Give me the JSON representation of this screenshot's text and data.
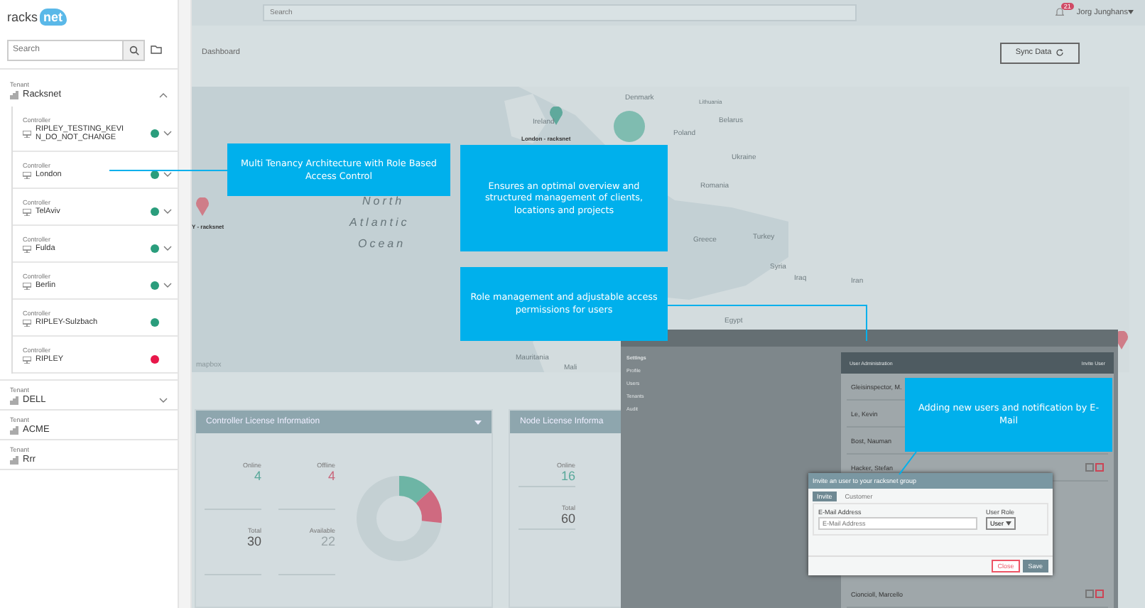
{
  "logo": {
    "part_a": "racks",
    "part_b": "net"
  },
  "sidebar": {
    "search": {
      "placeholder": "Search"
    },
    "tenants": [
      {
        "label": "Tenant",
        "name": "Racksnet",
        "expandable": true,
        "expanded": true,
        "children": [
          {
            "label": "Controller",
            "name": "RIPLEY_TESTING_KEVIN_DO_NOT_CHANGE",
            "color": "#2a9d7c",
            "expandable": true
          },
          {
            "label": "Controller",
            "name": "London",
            "color": "#2a9d7c",
            "expandable": true
          },
          {
            "label": "Controller",
            "name": "TelAviv",
            "color": "#2a9d7c",
            "expandable": true
          },
          {
            "label": "Controller",
            "name": "Fulda",
            "color": "#2a9d7c",
            "expandable": true
          },
          {
            "label": "Controller",
            "name": "Berlin",
            "color": "#2a9d7c",
            "expandable": true
          },
          {
            "label": "Controller",
            "name": "RIPLEY-Sulzbach",
            "color": "#2a9d7c",
            "expandable": false
          },
          {
            "label": "Controller",
            "name": "RIPLEY",
            "color": "#e8174a",
            "expandable": false
          }
        ]
      },
      {
        "label": "Tenant",
        "name": "DELL",
        "expandable": true,
        "expanded": false
      },
      {
        "label": "Tenant",
        "name": "ACME"
      },
      {
        "label": "Tenant",
        "name": "Rrr"
      }
    ]
  },
  "topbar": {
    "search": {
      "placeholder": "Search"
    },
    "notifications": "21",
    "user": "Jorg Junghans"
  },
  "dashboard": {
    "title": "Dashboard",
    "sync_button": "Sync Data"
  },
  "map": {
    "labels": [
      {
        "text": "Denmark",
        "kind": "country"
      },
      {
        "text": "Lithuania",
        "kind": "small"
      },
      {
        "text": "Belarus",
        "kind": "country"
      },
      {
        "text": "Poland",
        "kind": "country"
      },
      {
        "text": "Ireland",
        "kind": "country"
      },
      {
        "text": "London - racksnet",
        "kind": "pin"
      },
      {
        "text": "Ukraine",
        "kind": "country"
      },
      {
        "text": "Romania",
        "kind": "country"
      },
      {
        "text": "Greece",
        "kind": "country"
      },
      {
        "text": "Turkey",
        "kind": "country"
      },
      {
        "text": "Syria",
        "kind": "country"
      },
      {
        "text": "Iraq",
        "kind": "country"
      },
      {
        "text": "Iran",
        "kind": "country"
      },
      {
        "text": "Egypt",
        "kind": "country"
      },
      {
        "text": "Mauritania",
        "kind": "country"
      },
      {
        "text": "Mali",
        "kind": "country"
      },
      {
        "text": "North",
        "kind": "ocean"
      },
      {
        "text": "Atlantic",
        "kind": "ocean"
      },
      {
        "text": "Ocean",
        "kind": "ocean"
      },
      {
        "text": "Y - racksnet",
        "kind": "pin"
      }
    ],
    "markers": [
      {
        "kind": "pin",
        "color": "#5fa99c"
      },
      {
        "kind": "cluster",
        "color": "#7fbcb0"
      },
      {
        "kind": "pin",
        "color": "#cf7d88"
      },
      {
        "kind": "pin",
        "color": "#cf7d88"
      }
    ],
    "attribution": "mapbox"
  },
  "cards": [
    {
      "title": "Controller License Information",
      "stats": [
        {
          "label": "Online",
          "value": "4",
          "kind": "online"
        },
        {
          "label": "Offline",
          "value": "4",
          "kind": "offline"
        },
        {
          "label": "Total",
          "value": "30",
          "kind": "total"
        },
        {
          "label": "Available",
          "value": "22",
          "kind": "available"
        }
      ]
    },
    {
      "title": "Node License Informa",
      "stats": [
        {
          "label": "Online",
          "value": "16",
          "kind": "online"
        },
        {
          "label": "Total",
          "value": "60",
          "kind": "total"
        }
      ]
    }
  ],
  "inset": {
    "menu_title": "Settings",
    "menu": [
      "Profile",
      "Users",
      "Tenants",
      "Audit"
    ],
    "panel": {
      "title": "User Administration",
      "action": "Invite User",
      "users": [
        {
          "name": "Gleisinspector, M."
        },
        {
          "name": "Le, Kevin"
        },
        {
          "name": "Bost, Nauman"
        },
        {
          "name": "Hacker, Stefan",
          "actions": true
        },
        {
          "name": "Cioncioll, Marcello",
          "actions": true
        }
      ]
    },
    "modal": {
      "title": "Invite an user to your racksnet group",
      "tabs": [
        {
          "label": "Invite",
          "selected": true
        },
        {
          "label": "Customer",
          "selected": false
        }
      ],
      "email_label": "E-Mail Address",
      "email_placeholder": "E-Mail Address",
      "role_label": "User Role",
      "role_value": "User",
      "buttons": [
        {
          "label": "Close",
          "kind": "secondary"
        },
        {
          "label": "Save",
          "kind": "primary"
        }
      ]
    }
  },
  "callouts": [
    {
      "text": "Multi Tenancy Architecture with Role Based Access Control"
    },
    {
      "text": "Ensures an optimal overview and structured management of clients, locations and projects"
    },
    {
      "text": "Role management and adjustable access permissions for users"
    },
    {
      "text": "Adding new users and notification by E-Mail"
    }
  ]
}
